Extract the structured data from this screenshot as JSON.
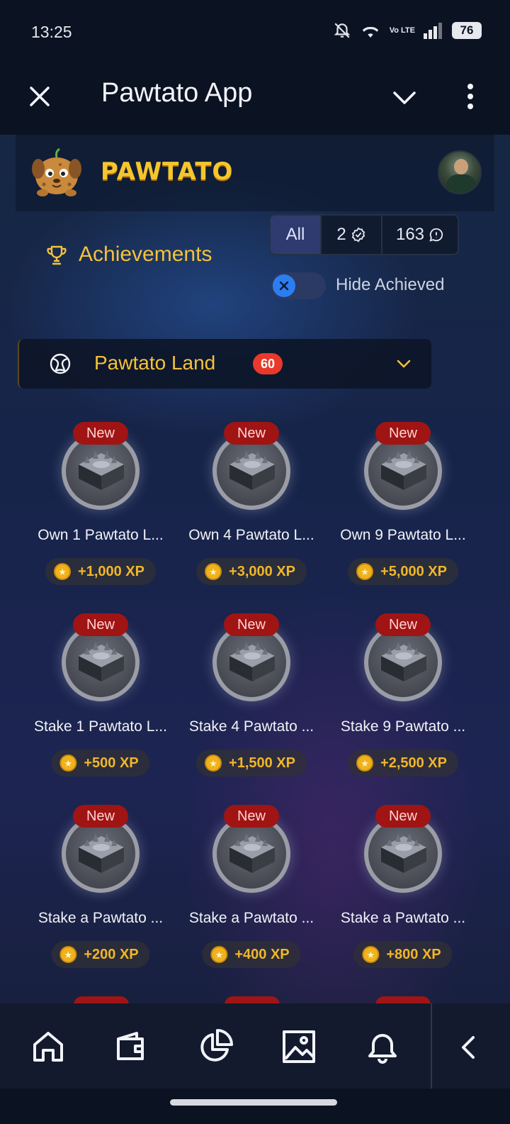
{
  "status_bar": {
    "time": "13:25",
    "network": "Vo LTE",
    "battery": "76"
  },
  "app_bar": {
    "title": "Pawtato App"
  },
  "site_header": {
    "brand": "PAWTATO"
  },
  "achievements": {
    "title": "Achievements",
    "filters": [
      {
        "label": "All",
        "active": true
      },
      {
        "label": "2",
        "icon": "check-circle-icon"
      },
      {
        "label": "163",
        "icon": "chat-icon"
      }
    ],
    "toggle_label": "Hide Achieved",
    "toggle_on": false
  },
  "category": {
    "label": "Pawtato Land",
    "count": "60"
  },
  "items": [
    {
      "badge": "New",
      "title": "Own 1 Pawtato L...",
      "xp": "+1,000 XP"
    },
    {
      "badge": "New",
      "title": "Own 4 Pawtato L...",
      "xp": "+3,000 XP"
    },
    {
      "badge": "New",
      "title": "Own 9 Pawtato L...",
      "xp": "+5,000 XP"
    },
    {
      "badge": "New",
      "title": "Stake 1 Pawtato L...",
      "xp": "+500 XP"
    },
    {
      "badge": "New",
      "title": "Stake 4 Pawtato ...",
      "xp": "+1,500 XP"
    },
    {
      "badge": "New",
      "title": "Stake 9 Pawtato ...",
      "xp": "+2,500 XP"
    },
    {
      "badge": "New",
      "title": "Stake a Pawtato ...",
      "xp": "+200 XP"
    },
    {
      "badge": "New",
      "title": "Stake a Pawtato ...",
      "xp": "+400 XP"
    },
    {
      "badge": "New",
      "title": "Stake a Pawtato ...",
      "xp": "+800 XP"
    }
  ],
  "bottom_nav": [
    "home-icon",
    "wallet-icon",
    "pie-chart-icon",
    "image-icon",
    "bell-icon",
    "back-chevron-icon"
  ],
  "colors": {
    "accent_gold": "#f4c23a",
    "badge_red": "#a01414",
    "count_red": "#e8392b",
    "active_filter": "#2f3b6e",
    "toggle_blue": "#2b7ef2"
  }
}
